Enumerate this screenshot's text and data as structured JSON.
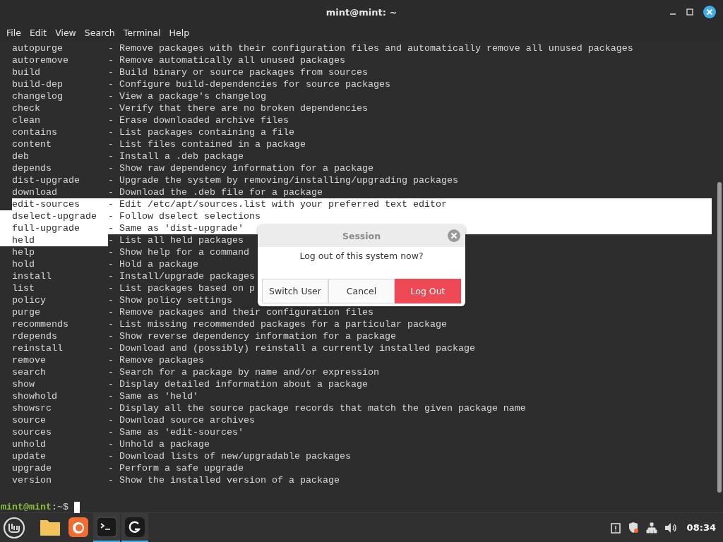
{
  "window": {
    "title": "mint@mint: ~"
  },
  "menu": [
    "File",
    "Edit",
    "View",
    "Search",
    "Terminal",
    "Help"
  ],
  "terminal": {
    "rows": [
      {
        "name": "autopurge",
        "desc": "- Remove packages with their configuration files and automatically remove all unused packages",
        "name_selected": false,
        "desc_selected": false
      },
      {
        "name": "autoremove",
        "desc": "- Remove automatically all unused packages",
        "name_selected": false,
        "desc_selected": false
      },
      {
        "name": "build",
        "desc": "- Build binary or source packages from sources",
        "name_selected": false,
        "desc_selected": false
      },
      {
        "name": "build-dep",
        "desc": "- Configure build-dependencies for source packages",
        "name_selected": false,
        "desc_selected": false
      },
      {
        "name": "changelog",
        "desc": "- View a package's changelog",
        "name_selected": false,
        "desc_selected": false
      },
      {
        "name": "check",
        "desc": "- Verify that there are no broken dependencies",
        "name_selected": false,
        "desc_selected": false
      },
      {
        "name": "clean",
        "desc": "- Erase downloaded archive files",
        "name_selected": false,
        "desc_selected": false
      },
      {
        "name": "contains",
        "desc": "- List packages containing a file",
        "name_selected": false,
        "desc_selected": false
      },
      {
        "name": "content",
        "desc": "- List files contained in a package",
        "name_selected": false,
        "desc_selected": false
      },
      {
        "name": "deb",
        "desc": "- Install a .deb package",
        "name_selected": false,
        "desc_selected": false
      },
      {
        "name": "depends",
        "desc": "- Show raw dependency information for a package",
        "name_selected": false,
        "desc_selected": false
      },
      {
        "name": "dist-upgrade",
        "desc": "- Upgrade the system by removing/installing/upgrading packages",
        "name_selected": false,
        "desc_selected": false
      },
      {
        "name": "download",
        "desc": "- Download the .deb file for a package",
        "name_selected": false,
        "desc_selected": false
      },
      {
        "name": "edit-sources",
        "desc": "- Edit /etc/apt/sources.list with your preferred text editor",
        "name_selected": true,
        "desc_selected": true
      },
      {
        "name": "dselect-upgrade",
        "desc": "- Follow dselect selections",
        "name_selected": true,
        "desc_selected": true
      },
      {
        "name": "full-upgrade",
        "desc": "- Same as 'dist-upgrade'",
        "name_selected": true,
        "desc_selected": true
      },
      {
        "name": "held",
        "desc": "- List all held packages",
        "name_selected": true,
        "desc_selected": false
      },
      {
        "name": "help",
        "desc": "- Show help for a command",
        "name_selected": false,
        "desc_selected": false
      },
      {
        "name": "hold",
        "desc": "- Hold a package",
        "name_selected": false,
        "desc_selected": false
      },
      {
        "name": "install",
        "desc": "- Install/upgrade packages",
        "name_selected": false,
        "desc_selected": false
      },
      {
        "name": "list",
        "desc": "- List packages based on p",
        "name_selected": false,
        "desc_selected": false
      },
      {
        "name": "policy",
        "desc": "- Show policy settings",
        "name_selected": false,
        "desc_selected": false
      },
      {
        "name": "purge",
        "desc": "- Remove packages and their configuration files",
        "name_selected": false,
        "desc_selected": false
      },
      {
        "name": "recommends",
        "desc": "- List missing recommended packages for a particular package",
        "name_selected": false,
        "desc_selected": false
      },
      {
        "name": "rdepends",
        "desc": "- Show reverse dependency information for a package",
        "name_selected": false,
        "desc_selected": false
      },
      {
        "name": "reinstall",
        "desc": "- Download and (possibly) reinstall a currently installed package",
        "name_selected": false,
        "desc_selected": false
      },
      {
        "name": "remove",
        "desc": "- Remove packages",
        "name_selected": false,
        "desc_selected": false
      },
      {
        "name": "search",
        "desc": "- Search for a package by name and/or expression",
        "name_selected": false,
        "desc_selected": false
      },
      {
        "name": "show",
        "desc": "- Display detailed information about a package",
        "name_selected": false,
        "desc_selected": false
      },
      {
        "name": "showhold",
        "desc": "- Same as 'held'",
        "name_selected": false,
        "desc_selected": false
      },
      {
        "name": "showsrc",
        "desc": "- Display all the source package records that match the given package name",
        "name_selected": false,
        "desc_selected": false
      },
      {
        "name": "source",
        "desc": "- Download source archives",
        "name_selected": false,
        "desc_selected": false
      },
      {
        "name": "sources",
        "desc": "- Same as 'edit-sources'",
        "name_selected": false,
        "desc_selected": false
      },
      {
        "name": "unhold",
        "desc": "- Unhold a package",
        "name_selected": false,
        "desc_selected": false
      },
      {
        "name": "update",
        "desc": "- Download lists of new/upgradable packages",
        "name_selected": false,
        "desc_selected": false
      },
      {
        "name": "upgrade",
        "desc": "- Perform a safe upgrade",
        "name_selected": false,
        "desc_selected": false
      },
      {
        "name": "version",
        "desc": "- Show the installed version of a package",
        "name_selected": false,
        "desc_selected": false
      }
    ],
    "prompt": {
      "user": "mint@mint",
      "path": ":~$"
    }
  },
  "dialog": {
    "title": "Session",
    "message": "Log out of this system now?",
    "buttons": [
      {
        "label": "Switch User",
        "kind": "normal"
      },
      {
        "label": "Cancel",
        "kind": "normal"
      },
      {
        "label": "Log Out",
        "kind": "danger"
      }
    ]
  },
  "taskbar": {
    "apps": [
      {
        "kind": "files",
        "selected": false
      },
      {
        "kind": "firefox",
        "selected": false
      },
      {
        "kind": "terminal",
        "selected": true
      },
      {
        "kind": "update",
        "selected": true
      }
    ],
    "clock": "08:34"
  }
}
